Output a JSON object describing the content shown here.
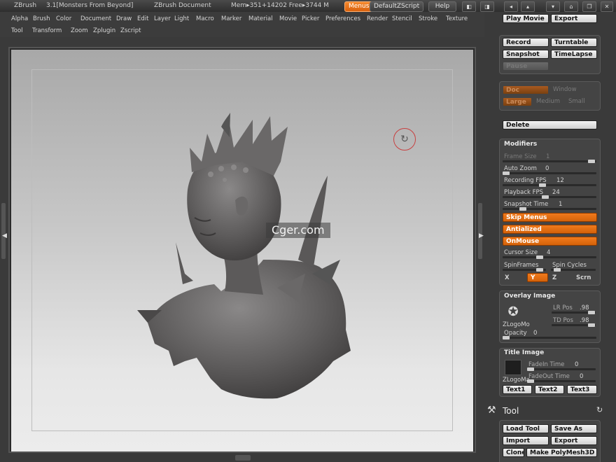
{
  "titlebar": {
    "app": "ZBrush",
    "version": "3.1[Monsters From Beyond]",
    "doc": "ZBrush Document",
    "mem": "Mem▸351+14202 Free▸3744 M",
    "menus_btn": "Menus",
    "script": "DefaultZScript",
    "help": "Help"
  },
  "menubar": {
    "row1": [
      "Alpha",
      "Brush",
      "Color",
      "Document",
      "Draw",
      "Edit",
      "Layer",
      "Light",
      "Macro",
      "Marker",
      "Material",
      "Movie",
      "Picker",
      "Preferences",
      "Render",
      "Stencil",
      "Stroke",
      "Texture"
    ],
    "row2": [
      "Tool",
      "Transform",
      "Zoom",
      "Zplugin",
      "Zscript"
    ]
  },
  "canvas": {
    "watermark": "Cger.com",
    "accent": "#ff7a1a"
  },
  "panel": {
    "movie": {
      "play": "Play Movie",
      "export": "Export"
    },
    "record": {
      "record": "Record",
      "turntable": "Turntable",
      "snapshot": "Snapshot",
      "timelapse": "TimeLapse",
      "pause": "Pause"
    },
    "window": {
      "doc": "Doc",
      "window": "Window",
      "large": "Large",
      "medium": "Medium",
      "small": "Small"
    },
    "delete": "Delete",
    "modifiers": {
      "title": "Modifiers",
      "frame_size": "Frame Size",
      "frame_size_val": "1",
      "auto_zoom": "Auto Zoom",
      "auto_zoom_val": "0",
      "rec_fps": "Recording FPS",
      "rec_fps_val": "12",
      "play_fps": "Playback FPS",
      "play_fps_val": "24",
      "snap_time": "Snapshot Time",
      "snap_time_val": "1",
      "skip_menus": "Skip Menus",
      "antialized": "Antialized",
      "onmouse": "OnMouse",
      "cursor_size": "Cursor Size",
      "cursor_size_val": "4",
      "spinframes": "SpinFrames",
      "spin_cycles": "Spin Cycles",
      "x": "X",
      "y": "Y",
      "z": "Z",
      "scrn": "Scrn"
    },
    "overlay": {
      "title": "Overlay Image",
      "logo": "ZLogoMo",
      "lr_pos": "LR Pos",
      "lr_pos_val": ".98",
      "td_pos": "TD Pos",
      "td_pos_val": ".98",
      "opacity": "Opacity",
      "opacity_val": "0"
    },
    "title_image": {
      "title": "Title Image",
      "logo": "ZLogoMa",
      "fadein": "FadeIn Time",
      "fadein_val": "0",
      "fadeout": "FadeOut Time",
      "fadeout_val": "0",
      "text1": "Text1",
      "text2": "Text2",
      "text3": "Text3"
    },
    "tool": {
      "title": "Tool",
      "load": "Load Tool",
      "saveas": "Save As",
      "import": "Import",
      "export": "Export",
      "clone": "Clone",
      "polymesh": "Make PolyMesh3D"
    }
  }
}
